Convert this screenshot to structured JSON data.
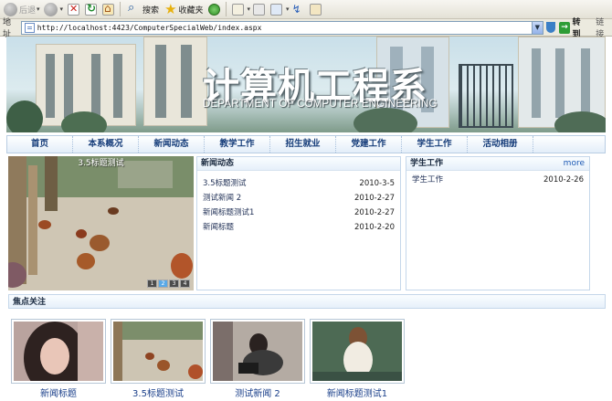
{
  "browser": {
    "toolbar": {
      "back_label": "后退",
      "search_label": "搜索",
      "favorites_label": "收藏夹"
    },
    "address": {
      "label": "地址",
      "url": "http://localhost:4423/ComputerSpecialWeb/index.aspx",
      "go_label": "转到",
      "links_label": "链接"
    }
  },
  "site": {
    "banner_title": "计算机工程系",
    "banner_subtitle": "DEPARTMENT  OF  COMPUTER  ENGINEERING"
  },
  "nav": [
    "首页",
    "本系概况",
    "新闻动态",
    "教学工作",
    "招生就业",
    "党建工作",
    "学生工作",
    "活动相册"
  ],
  "slider": {
    "caption": "3.5标题测试",
    "dots": [
      "1",
      "2",
      "3",
      "4"
    ]
  },
  "news": {
    "title": "新闻动态",
    "items": [
      {
        "title": "3.5标题测试",
        "date": "2010-3-5"
      },
      {
        "title": "测试新闻 2",
        "date": "2010-2-27"
      },
      {
        "title": "新闻标题测试1",
        "date": "2010-2-27"
      },
      {
        "title": "新闻标题",
        "date": "2010-2-20"
      }
    ]
  },
  "student": {
    "title": "学生工作",
    "more": "more",
    "items": [
      {
        "title": "学生工作",
        "date": "2010-2-26"
      }
    ]
  },
  "focus": {
    "title": "焦点关注",
    "items": [
      {
        "caption": "新闻标题"
      },
      {
        "caption": "3.5标题测试"
      },
      {
        "caption": "测试新闻 2"
      },
      {
        "caption": "新闻标题测试1"
      }
    ]
  }
}
